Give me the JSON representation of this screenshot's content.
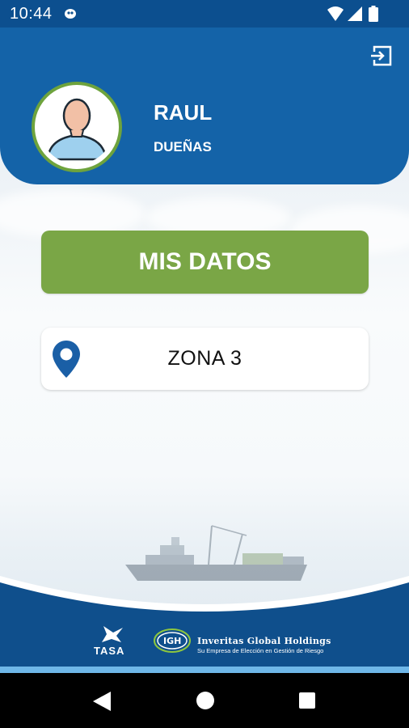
{
  "status_bar": {
    "time": "10:44"
  },
  "profile": {
    "first_name": "RAUL",
    "last_name": "DUEÑAS"
  },
  "main": {
    "primary_button_label": "MIS DATOS",
    "zone_label": "ZONA 3"
  },
  "footer": {
    "logo_left_text": "TASA",
    "logo_right_name": "Inveritas Global Holdings",
    "logo_right_tagline": "Su Empresa de Elección en Gestión de Riesgo"
  },
  "icons": {
    "logout": "logout-icon",
    "avatar": "user-avatar-icon",
    "location": "location-pin-icon",
    "nav_back": "back-triangle-icon",
    "nav_home": "home-circle-icon",
    "nav_recent": "recent-square-icon"
  },
  "colors": {
    "header_blue": "#1463a8",
    "statusbar_blue": "#0c4f8f",
    "accent_green": "#7aa646",
    "avatar_ring_green": "#6ea33d",
    "pin_blue": "#1a5fa6",
    "footer_accent": "#6fb7e8"
  }
}
